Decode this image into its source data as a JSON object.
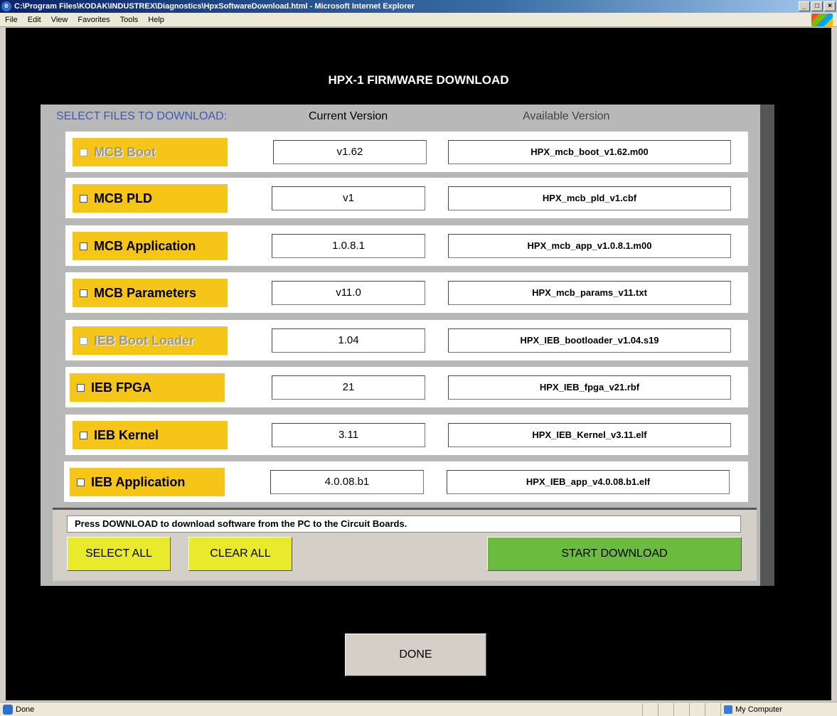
{
  "window": {
    "title": "C:\\Program Files\\KODAK\\INDUSTREX\\Diagnostics\\HpxSoftwareDownload.html - Microsoft Internet Explorer",
    "minimize": "_",
    "maximize": "□",
    "close": "×"
  },
  "menu": [
    "File",
    "Edit",
    "View",
    "Favorites",
    "Tools",
    "Help"
  ],
  "page": {
    "title": "HPX-1 FIRMWARE DOWNLOAD",
    "headers": {
      "select": "SELECT FILES TO DOWNLOAD:",
      "current": "Current Version",
      "available": "Available Version"
    },
    "rows": [
      {
        "label": "MCB Boot",
        "current": "v1.62",
        "available": "HPX_mcb_boot_v1.62.m00",
        "enabled": false,
        "checked": false
      },
      {
        "label": "MCB PLD",
        "current": "v1",
        "available": "HPX_mcb_pld_v1.cbf",
        "enabled": true,
        "checked": false
      },
      {
        "label": "MCB Application",
        "current": "1.0.8.1",
        "available": "HPX_mcb_app_v1.0.8.1.m00",
        "enabled": true,
        "checked": false
      },
      {
        "label": "MCB Parameters",
        "current": "v11.0",
        "available": "HPX_mcb_params_v11.txt",
        "enabled": true,
        "checked": false
      },
      {
        "label": "IEB Boot Loader",
        "current": "1.04",
        "available": "HPX_IEB_bootloader_v1.04.s19",
        "enabled": false,
        "checked": false
      },
      {
        "label": "IEB FPGA",
        "current": "21",
        "available": "HPX_IEB_fpga_v21.rbf",
        "enabled": true,
        "checked": false
      },
      {
        "label": "IEB Kernel",
        "current": "3.11",
        "available": "HPX_IEB_Kernel_v3.11.elf",
        "enabled": true,
        "checked": false
      },
      {
        "label": "IEB Application",
        "current": "4.0.08.b1",
        "available": "HPX_IEB_app_v4.0.08.b1.elf",
        "enabled": true,
        "checked": false
      }
    ],
    "message": "Press DOWNLOAD to download software from the PC to the Circuit Boards.",
    "buttons": {
      "select_all": "SELECT ALL",
      "clear_all": "CLEAR ALL",
      "start_download": "START DOWNLOAD",
      "done": "DONE"
    }
  },
  "status": {
    "text": "Done",
    "zone": "My Computer"
  },
  "colors": {
    "label_bg": "#f5c518",
    "start_download": "#6abb3f",
    "select_clear": "#eaea2c",
    "header_select": "#3d5bb5"
  }
}
